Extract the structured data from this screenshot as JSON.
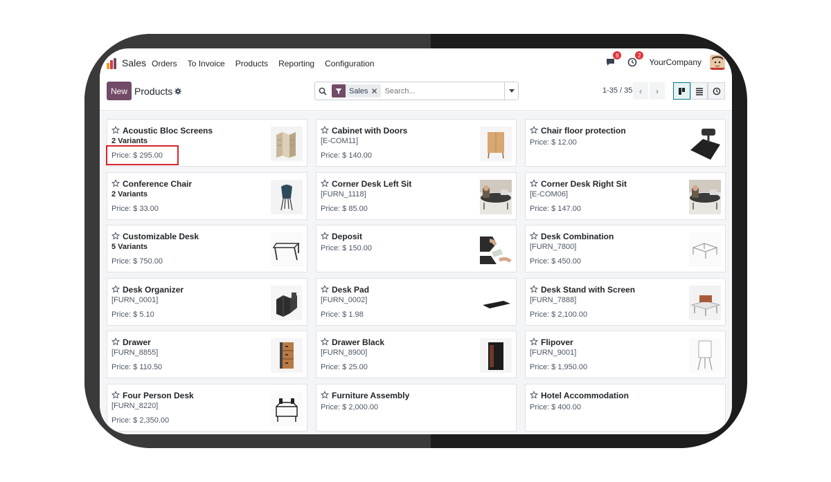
{
  "nav": {
    "app_name": "Sales",
    "menu": [
      "Orders",
      "To Invoice",
      "Products",
      "Reporting",
      "Configuration"
    ],
    "messages_count": "6",
    "activities_count": "2",
    "company": "YourCompany"
  },
  "control": {
    "new_label": "New",
    "title": "Products",
    "facet_label": "Sales",
    "search_placeholder": "Search...",
    "pager": "1-35 / 35"
  },
  "colors": {
    "brand": "#714b67",
    "highlight": "#d9232a",
    "active_view": "#017e84"
  },
  "products": [
    {
      "name": "Acoustic Bloc Screens",
      "sub": "2 Variants",
      "sub_bold": true,
      "price": "Price: $ 295.00",
      "icon": "screens-image"
    },
    {
      "name": "Cabinet with Doors",
      "sub": "[E-COM11]",
      "sub_bold": false,
      "price": "Price: $ 140.00",
      "icon": "cabinet-image"
    },
    {
      "name": "Chair floor protection",
      "sub": "",
      "sub_bold": false,
      "price": "Price: $ 12.00",
      "icon": "floor-mat-image"
    },
    {
      "name": "Conference Chair",
      "sub": "2 Variants",
      "sub_bold": true,
      "price": "Price: $ 33.00",
      "icon": "chair-image"
    },
    {
      "name": "Corner Desk Left Sit",
      "sub": "[FURN_1118]",
      "sub_bold": false,
      "price": "Price: $ 85.00",
      "icon": "desk-photo-image"
    },
    {
      "name": "Corner Desk Right Sit",
      "sub": "[E-COM06]",
      "sub_bold": false,
      "price": "Price: $ 147.00",
      "icon": "desk-photo-image"
    },
    {
      "name": "Customizable Desk",
      "sub": "5 Variants",
      "sub_bold": true,
      "price": "Price: $ 750.00",
      "icon": "desk-image"
    },
    {
      "name": "Deposit",
      "sub": "",
      "sub_bold": false,
      "price": "Price: $ 150.00",
      "icon": "deposit-image"
    },
    {
      "name": "Desk Combination",
      "sub": "[FURN_7800]",
      "sub_bold": false,
      "price": "Price: $ 450.00",
      "icon": "desk-combo-image"
    },
    {
      "name": "Desk Organizer",
      "sub": "[FURN_0001]",
      "sub_bold": false,
      "price": "Price: $ 5.10",
      "icon": "organizer-image"
    },
    {
      "name": "Desk Pad",
      "sub": "[FURN_0002]",
      "sub_bold": false,
      "price": "Price: $ 1.98",
      "icon": "desk-pad-image"
    },
    {
      "name": "Desk Stand with Screen",
      "sub": "[FURN_7888]",
      "sub_bold": false,
      "price": "Price: $ 2,100.00",
      "icon": "desk-stand-image"
    },
    {
      "name": "Drawer",
      "sub": "[FURN_8855]",
      "sub_bold": false,
      "price": "Price: $ 110.50",
      "icon": "drawer-image"
    },
    {
      "name": "Drawer Black",
      "sub": "[FURN_8900]",
      "sub_bold": false,
      "price": "Price: $ 25.00",
      "icon": "drawer-black-image"
    },
    {
      "name": "Flipover",
      "sub": "[FURN_9001]",
      "sub_bold": false,
      "price": "Price: $ 1,950.00",
      "icon": "flipover-image"
    },
    {
      "name": "Four Person Desk",
      "sub": "[FURN_8220]",
      "sub_bold": false,
      "price": "Price: $ 2,350.00",
      "icon": "four-desk-image"
    },
    {
      "name": "Furniture Assembly",
      "sub": "",
      "sub_bold": false,
      "price": "Price: $ 2,000.00",
      "icon": ""
    },
    {
      "name": "Hotel Accommodation",
      "sub": "",
      "sub_bold": false,
      "price": "Price: $ 400.00",
      "icon": ""
    }
  ]
}
